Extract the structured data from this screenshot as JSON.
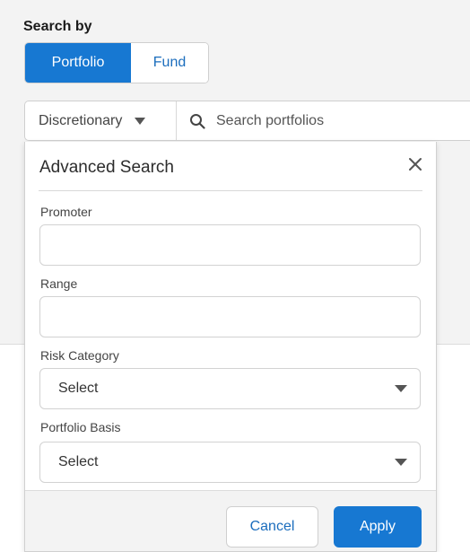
{
  "search_by": {
    "label": "Search by",
    "options": [
      {
        "label": "Portfolio",
        "active": true
      },
      {
        "label": "Fund",
        "active": false
      }
    ]
  },
  "search_bar": {
    "scope_value": "Discretionary",
    "placeholder": "Search portfolios",
    "value": ""
  },
  "advanced_search": {
    "title": "Advanced Search",
    "fields": {
      "promoter": {
        "label": "Promoter",
        "value": ""
      },
      "range": {
        "label": "Range",
        "value": ""
      },
      "risk_category": {
        "label": "Risk Category",
        "value": "Select"
      },
      "portfolio_basis": {
        "label": "Portfolio Basis",
        "value": "Select"
      }
    },
    "buttons": {
      "cancel": "Cancel",
      "apply": "Apply"
    }
  },
  "icons": {
    "search": "search-icon",
    "close": "close-icon",
    "dropdown": "caret-down-icon"
  },
  "colors": {
    "accent": "#1778d2",
    "link": "#1b6dbd",
    "background": "#f3f3f3"
  }
}
